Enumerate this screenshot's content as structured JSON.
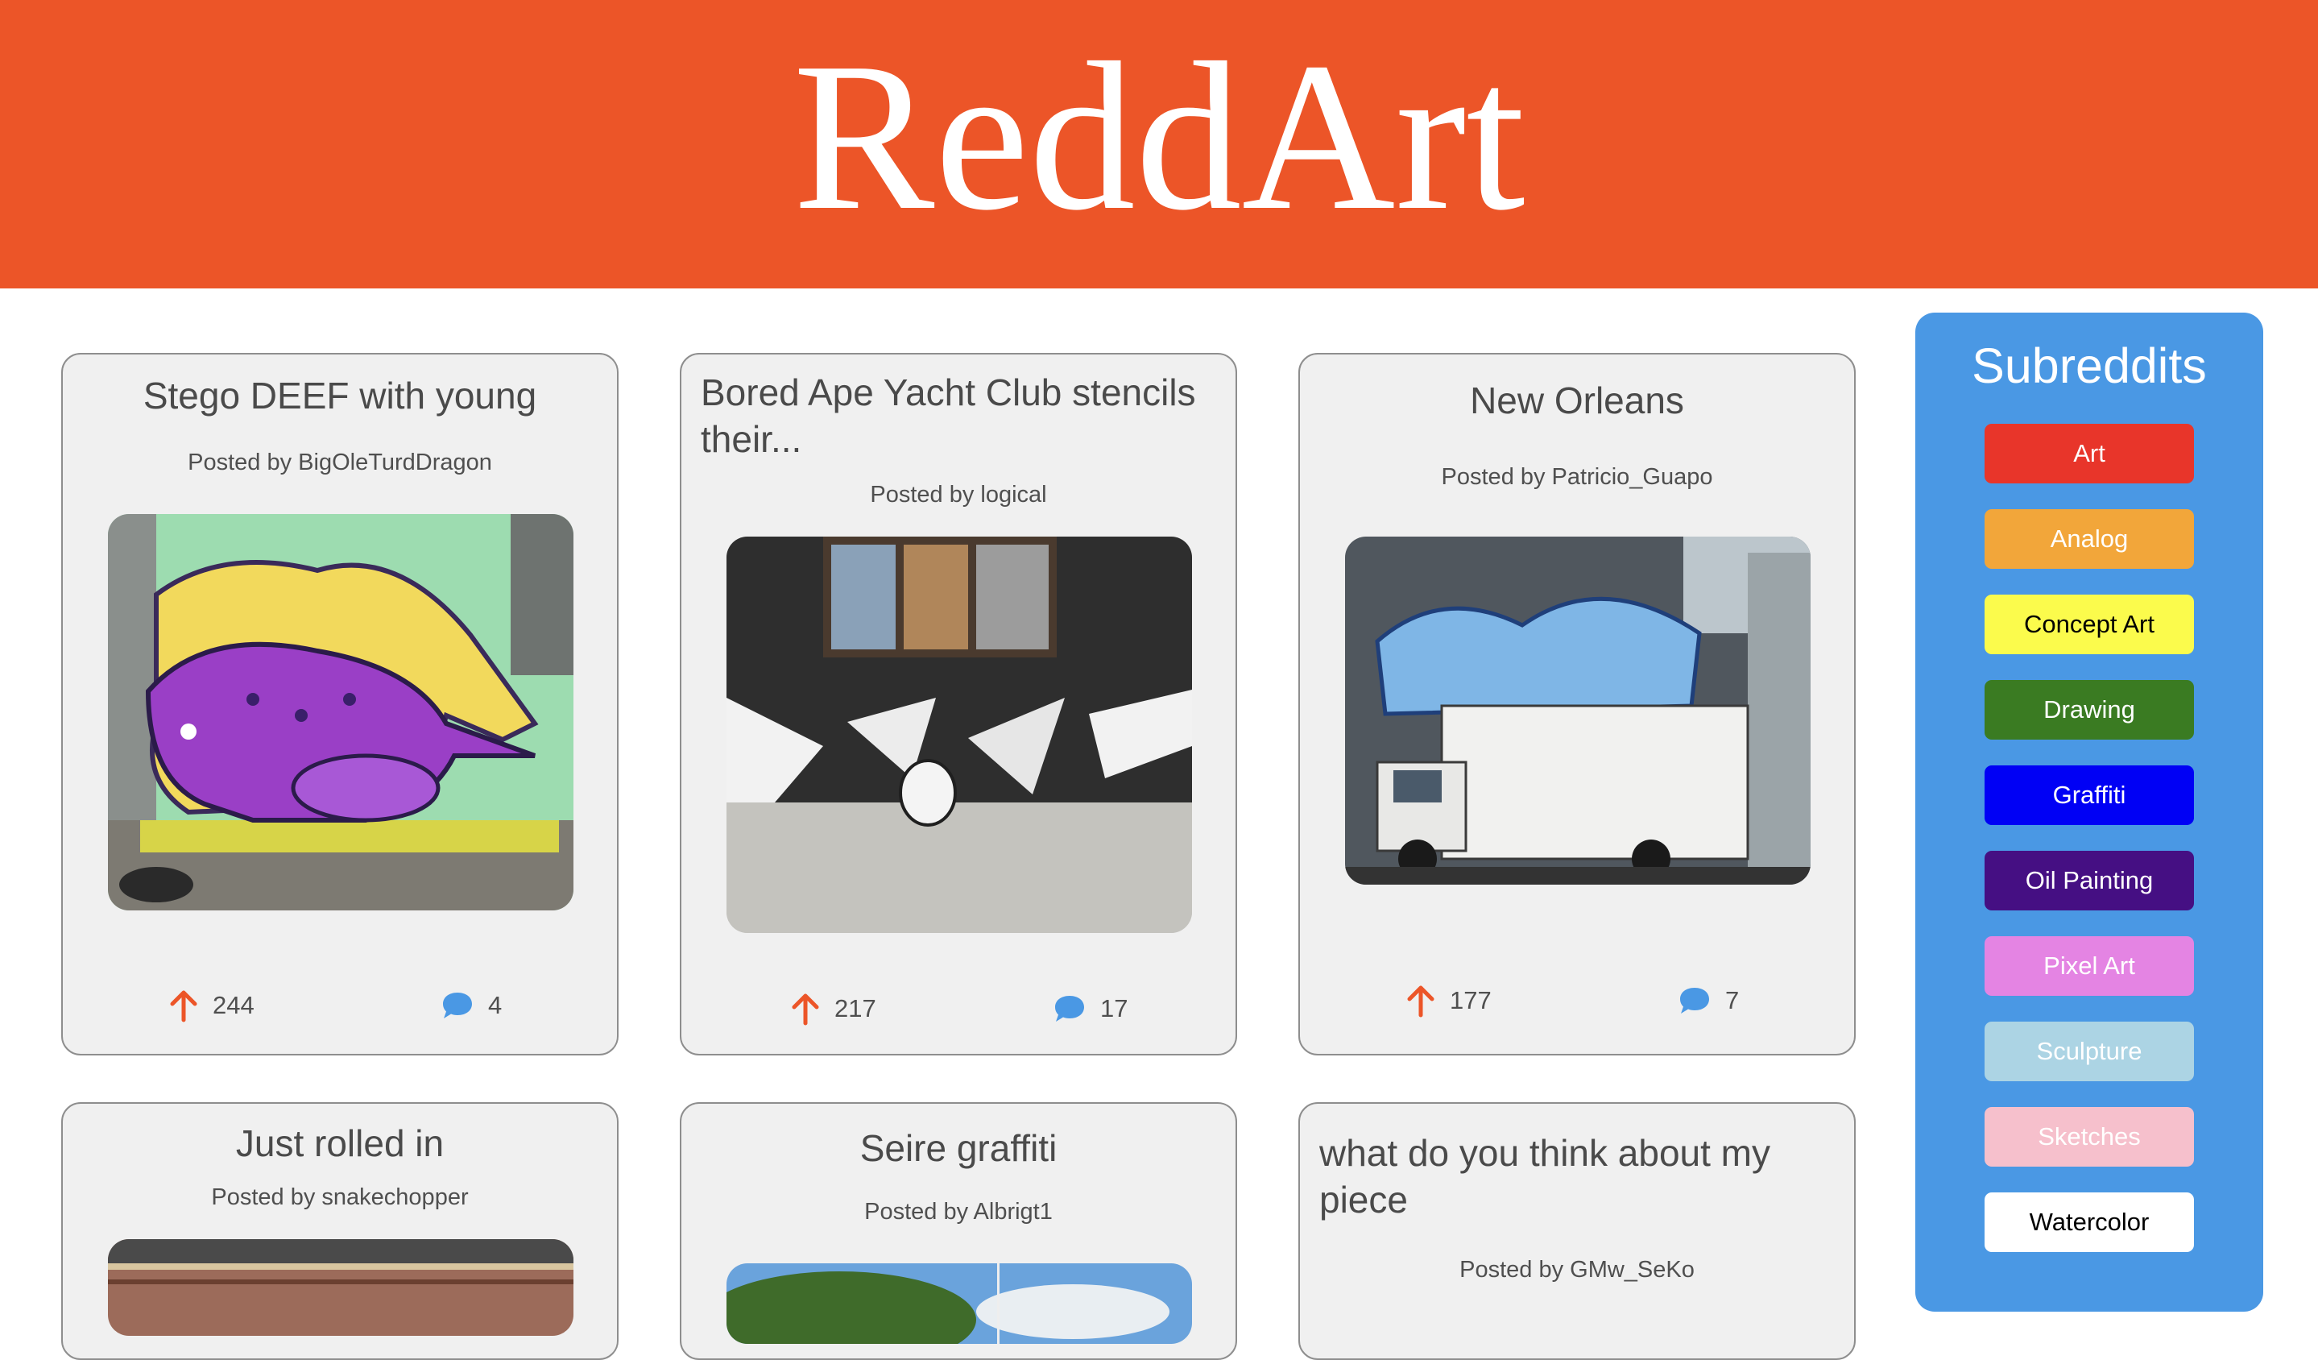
{
  "app": {
    "title": "ReddArt"
  },
  "posts": [
    {
      "title": "Stego DEEF with young",
      "author": "Posted by BigOleTurdDragon",
      "upvotes": "244",
      "comments": "4",
      "image": "graffiti-stegosaurus-photo"
    },
    {
      "title": "Bored Ape Yacht Club stencils their...",
      "author": "Posted by logical",
      "upvotes": "217",
      "comments": "17",
      "image": "ape-stencil-wall-photo"
    },
    {
      "title": "New Orleans",
      "author": "Posted by Patricio_Guapo",
      "upvotes": "177",
      "comments": "7",
      "image": "graffiti-truck-photo"
    },
    {
      "title": "Just rolled in",
      "author": "Posted by snakechopper",
      "image": "train-car-photo"
    },
    {
      "title": "Seire graffiti",
      "author": "Posted by Albrigt1",
      "image": "sky-trees-photo"
    },
    {
      "title": "what do you think about my piece",
      "author": "Posted by GMw_SeKo"
    }
  ],
  "sidebar": {
    "title": "Subreddits",
    "items": [
      {
        "label": "Art",
        "bg": "#e8352a",
        "fg": "#ffffff"
      },
      {
        "label": "Analog",
        "bg": "#f2a63a",
        "fg": "#ffffff"
      },
      {
        "label": "Concept Art",
        "bg": "#fbfb4c",
        "fg": "#000000"
      },
      {
        "label": "Drawing",
        "bg": "#3a7b22",
        "fg": "#ffffff"
      },
      {
        "label": "Graffiti",
        "bg": "#0000f5",
        "fg": "#ffffff"
      },
      {
        "label": "Oil Painting",
        "bg": "#450f83",
        "fg": "#ffffff"
      },
      {
        "label": "Pixel Art",
        "bg": "#e484e3",
        "fg": "#ffffff"
      },
      {
        "label": "Sculpture",
        "bg": "#acd4e4",
        "fg": "#ffffff"
      },
      {
        "label": "Sketches",
        "bg": "#f6c0cc",
        "fg": "#ffffff"
      },
      {
        "label": "Watercolor",
        "bg": "#ffffff",
        "fg": "#000000"
      }
    ]
  },
  "colors": {
    "header": "#ec5528",
    "upvote": "#ec5528",
    "comment": "#4a98e4",
    "sidebar": "#4a98e4"
  }
}
